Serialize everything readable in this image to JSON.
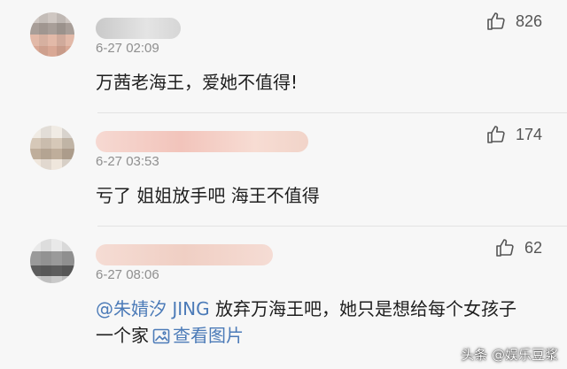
{
  "comments": [
    {
      "timestamp": "6-27 02:09",
      "likes": "826",
      "text": "万茜老海王，爱她不值得!"
    },
    {
      "timestamp": "6-27 03:53",
      "likes": "174",
      "text": "亏了 姐姐放手吧 海王不值得"
    },
    {
      "timestamp": "6-27 08:06",
      "likes": "62",
      "mention": "@朱婧汐 JING",
      "text": " 放弃万海王吧，她只是想给每个女孩子一个家",
      "view_image": "查看图片"
    }
  ],
  "watermark": "头条 @娱乐豆浆",
  "colors": {
    "link": "#4c7bb8",
    "background": "#f7f7f7",
    "timestamp": "#8f8f8f"
  },
  "icons": {
    "like": "thumbs-up-icon",
    "image": "image-icon"
  }
}
